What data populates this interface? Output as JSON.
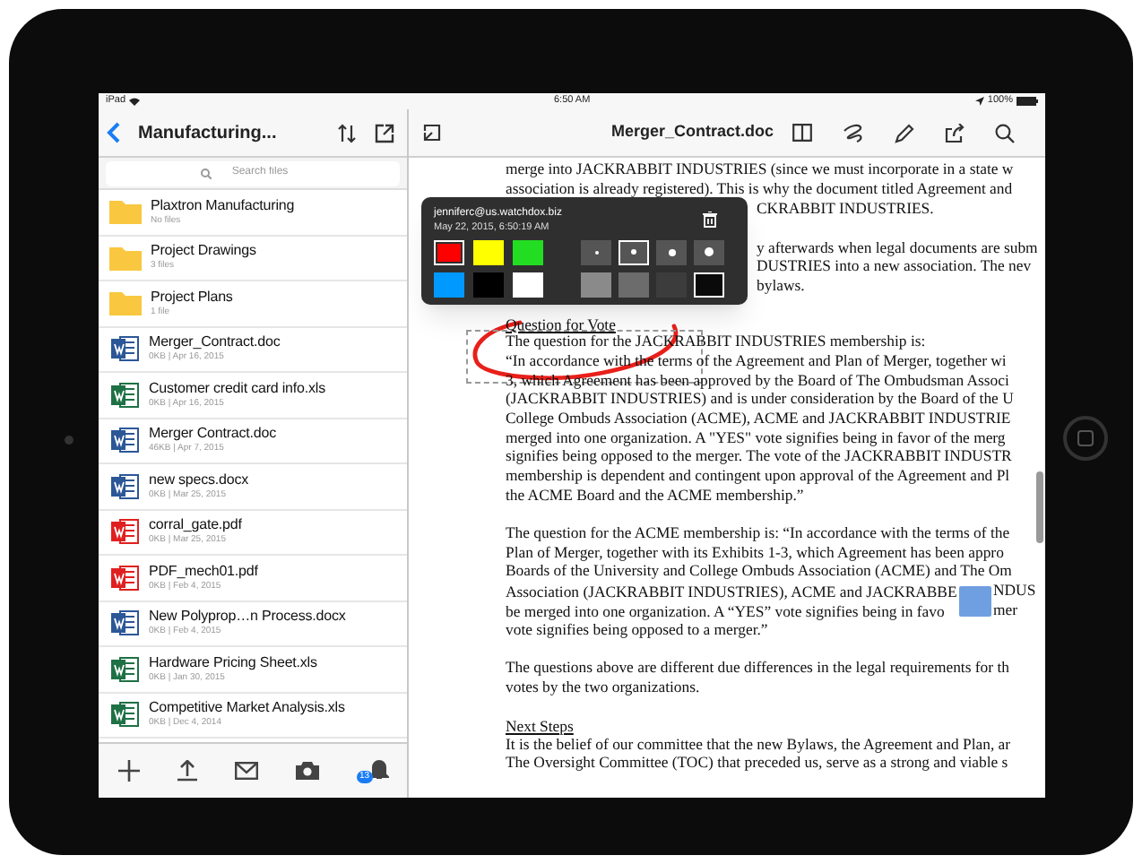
{
  "status_bar": {
    "device": "iPad",
    "time": "6:50 AM",
    "battery": "100%"
  },
  "sidebar": {
    "title": "Manufacturing...",
    "search": {
      "placeholder": "Search files"
    },
    "items": [
      {
        "kind": "folder",
        "name": "Plaxtron Manufacturing",
        "meta": "No files"
      },
      {
        "kind": "folder",
        "name": "Project Drawings",
        "meta": "3 files"
      },
      {
        "kind": "folder",
        "name": "Project Plans",
        "meta": "1 file"
      },
      {
        "kind": "word",
        "name": "Merger_Contract.doc",
        "meta": "0KB | Apr 16, 2015"
      },
      {
        "kind": "excel",
        "name": "Customer credit card info.xls",
        "meta": "0KB | Apr 16, 2015"
      },
      {
        "kind": "word",
        "name": "Merger Contract.doc",
        "meta": "46KB | Apr 7, 2015"
      },
      {
        "kind": "word",
        "name": "new specs.docx",
        "meta": "0KB | Mar 25, 2015"
      },
      {
        "kind": "pdf",
        "name": "corral_gate.pdf",
        "meta": "0KB | Mar 25, 2015"
      },
      {
        "kind": "pdf",
        "name": "PDF_mech01.pdf",
        "meta": "0KB | Feb 4, 2015"
      },
      {
        "kind": "word",
        "name": "New Polyprop…n Process.docx",
        "meta": "0KB | Feb 4, 2015"
      },
      {
        "kind": "excel",
        "name": "Hardware Pricing Sheet.xls",
        "meta": "0KB | Jan 30, 2015"
      },
      {
        "kind": "excel",
        "name": "Competitive Market Analysis.xls",
        "meta": "0KB | Dec 4, 2014"
      }
    ],
    "toolbar": {
      "badge": "13"
    }
  },
  "document": {
    "title": "Merger_Contract.doc",
    "lines": [
      {
        "kind": "text",
        "text": "merge into JACKRABBIT INDUSTRIES (since we must incorporate in a state w"
      },
      {
        "kind": "text",
        "text": "association is already registered). This is why the document titled Agreement and"
      },
      {
        "kind": "covered",
        "text": "CKRABBIT INDUSTRIES."
      },
      {
        "kind": "blank"
      },
      {
        "kind": "covered",
        "text": "y afterwards when legal documents are subm"
      },
      {
        "kind": "covered",
        "text": "DUSTRIES into a new association. The nev"
      },
      {
        "kind": "covered",
        "text": "bylaws."
      },
      {
        "kind": "blank"
      },
      {
        "kind": "heading",
        "text": "Question for Vote"
      },
      {
        "kind": "text",
        "text": "The question for the JACKRABBIT INDUSTRIES membership is:"
      },
      {
        "kind": "text",
        "text": "“In accordance with the terms of the Agreement and Plan of Merger, together wi"
      },
      {
        "kind": "text",
        "text": "3, which Agreement has been approved by the Board of The Ombudsman Associ"
      },
      {
        "kind": "text",
        "text": "(JACKRABBIT INDUSTRIES) and is under consideration by the Board of the U"
      },
      {
        "kind": "text",
        "text": "College Ombuds Association (ACME), ACME and JACKRABBIT INDUSTRIE"
      },
      {
        "kind": "text",
        "text": "merged into one organization.  A \"YES\" vote signifies being in favor of the merg"
      },
      {
        "kind": "text",
        "text": "signifies being opposed to the merger. The vote of the JACKRABBIT INDUSTR"
      },
      {
        "kind": "text",
        "text": "membership is dependent and contingent upon approval of the Agreement and Pl"
      },
      {
        "kind": "text",
        "text": "the ACME Board and the ACME membership.”"
      },
      {
        "kind": "blank"
      },
      {
        "kind": "text",
        "text": "The question for the ACME membership is: “In accordance with the terms of the"
      },
      {
        "kind": "text",
        "text": "Plan of Merger, together with its Exhibits 1-3, which Agreement has been appro"
      },
      {
        "kind": "text",
        "text": "Boards of the University and College Ombuds Association (ACME) and The Om"
      },
      {
        "kind": "split",
        "text": "Association (JACKRABBIT INDUSTRIES), ACME and JACKRABBE",
        "rest": "NDUS"
      },
      {
        "kind": "split",
        "text": "be merged into one organization. A “YES” vote signifies being in favo",
        "rest": "mer"
      },
      {
        "kind": "text",
        "text": "vote signifies being opposed to a merger.”"
      },
      {
        "kind": "blank"
      },
      {
        "kind": "text",
        "text": "The questions above are different due differences in the legal requirements for th"
      },
      {
        "kind": "text",
        "text": "votes by the two organizations."
      },
      {
        "kind": "blank"
      },
      {
        "kind": "heading",
        "text": "Next Steps"
      },
      {
        "kind": "text",
        "text": "It is the belief of our committee that the new Bylaws, the Agreement and Plan, ar"
      },
      {
        "kind": "text",
        "text": "The Oversight Committee (TOC) that preceded us, serve as a strong and viable s"
      }
    ]
  },
  "annotation_popup": {
    "author": "jenniferc@us.watchdox.biz",
    "date": "May 22, 2015, 6:50:19 AM",
    "colors": [
      {
        "color": "#ff0000",
        "selected": true
      },
      {
        "color": "#ffff00",
        "selected": false
      },
      {
        "color": "#22dd22",
        "selected": false
      },
      {
        "color": "#0099ff",
        "selected": false
      },
      {
        "color": "#000000",
        "selected": false
      },
      {
        "color": "#ffffff",
        "selected": false
      }
    ],
    "widths": [
      {
        "selected": false
      },
      {
        "selected": true
      },
      {
        "selected": false
      },
      {
        "selected": false
      }
    ],
    "opacities": [
      {
        "selected": false
      },
      {
        "selected": false
      },
      {
        "selected": false
      },
      {
        "selected": true
      }
    ]
  }
}
